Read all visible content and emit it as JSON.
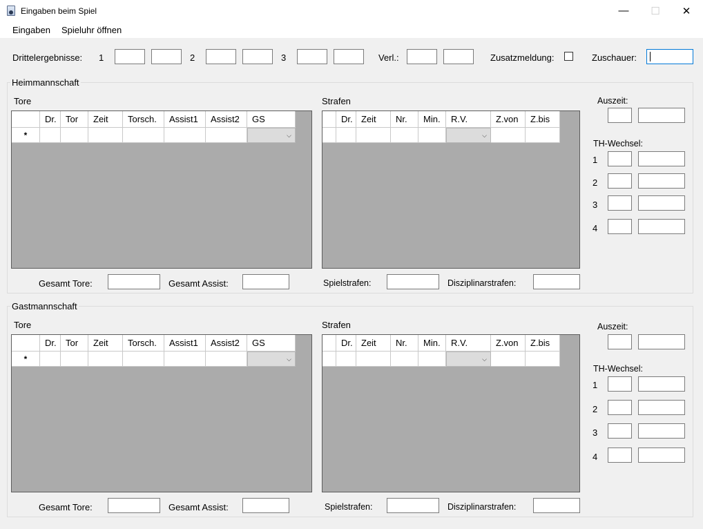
{
  "window": {
    "title": "Eingaben beim Spiel",
    "minimize": "—",
    "maximize": "☐",
    "close": "✕"
  },
  "menu": {
    "items": [
      "Eingaben",
      "Spieluhr öffnen"
    ]
  },
  "top": {
    "drittel_label": "Drittelergebnisse:",
    "p1": "1",
    "p2": "2",
    "p3": "3",
    "verl_label": "Verl.:",
    "zusatz_label": "Zusatzmeldung:",
    "zuschauer_label": "Zuschauer:"
  },
  "home": {
    "title": "Heimmannschaft",
    "tore_title": "Tore",
    "strafen_title": "Strafen",
    "goals_columns": [
      "Dr.",
      "Tor",
      "Zeit",
      "Torsch.",
      "Assist1",
      "Assist2",
      "GS"
    ],
    "penalty_columns": [
      "Dr.",
      "Zeit",
      "Nr.",
      "Min.",
      "R.V.",
      "Z.von",
      "Z.bis"
    ],
    "new_row_marker": "*",
    "gesamt_tore": "Gesamt Tore:",
    "gesamt_assist": "Gesamt Assist:",
    "spielstrafen": "Spielstrafen:",
    "disziplinar": "Disziplinarstrafen:",
    "auszeit": "Auszeit:",
    "th_wechsel": "TH-Wechsel:",
    "th_rows": [
      "1",
      "2",
      "3",
      "4"
    ]
  },
  "guest": {
    "title": "Gastmannschaft",
    "tore_title": "Tore",
    "strafen_title": "Strafen",
    "goals_columns": [
      "Dr.",
      "Tor",
      "Zeit",
      "Torsch.",
      "Assist1",
      "Assist2",
      "GS"
    ],
    "penalty_columns": [
      "Dr.",
      "Zeit",
      "Nr.",
      "Min.",
      "R.V.",
      "Z.von",
      "Z.bis"
    ],
    "new_row_marker": "*",
    "gesamt_tore": "Gesamt Tore:",
    "gesamt_assist": "Gesamt Assist:",
    "spielstrafen": "Spielstrafen:",
    "disziplinar": "Disziplinarstrafen:",
    "auszeit": "Auszeit:",
    "th_wechsel": "TH-Wechsel:",
    "th_rows": [
      "1",
      "2",
      "3",
      "4"
    ]
  },
  "icons": {
    "app": "app-icon",
    "dropdown": "chevron-down-icon"
  },
  "colors": {
    "focus_border": "#0078d7",
    "grid_background": "#ababab",
    "window_background": "#f0f0f0"
  }
}
